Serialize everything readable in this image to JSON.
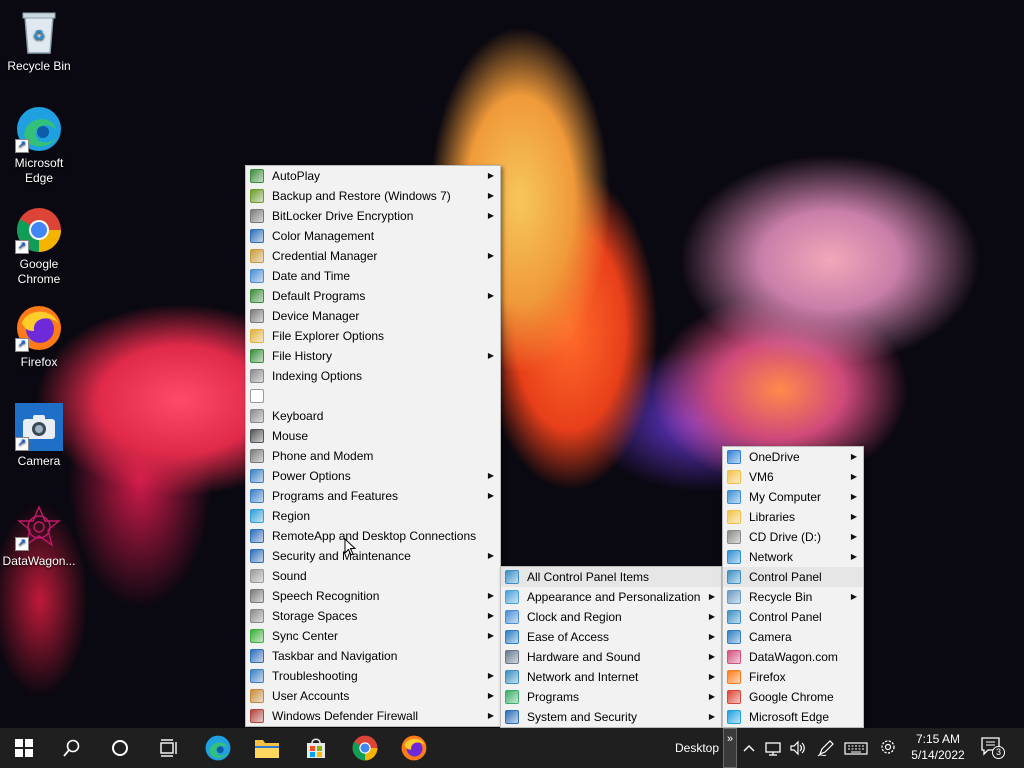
{
  "desktop_icons": [
    {
      "label": "Recycle Bin",
      "icon": "recycle-bin-icon"
    },
    {
      "label": "Microsoft Edge",
      "icon": "edge-icon"
    },
    {
      "label": "Google Chrome",
      "icon": "chrome-icon"
    },
    {
      "label": "Firefox",
      "icon": "firefox-icon"
    },
    {
      "label": "Camera",
      "icon": "camera-icon"
    },
    {
      "label": "DataWagon...",
      "icon": "datawagon-icon"
    }
  ],
  "control_panel_menu": [
    {
      "label": "AutoPlay",
      "submenu": true
    },
    {
      "label": "Backup and Restore (Windows 7)",
      "submenu": true
    },
    {
      "label": "BitLocker Drive Encryption",
      "submenu": true
    },
    {
      "label": "Color Management",
      "submenu": false
    },
    {
      "label": "Credential Manager",
      "submenu": true
    },
    {
      "label": "Date and Time",
      "submenu": false
    },
    {
      "label": "Default Programs",
      "submenu": true
    },
    {
      "label": "Device Manager",
      "submenu": false
    },
    {
      "label": "File Explorer Options",
      "submenu": false
    },
    {
      "label": "File History",
      "submenu": true
    },
    {
      "label": "Indexing Options",
      "submenu": false
    },
    {
      "label": "",
      "submenu": false
    },
    {
      "label": "Keyboard",
      "submenu": false
    },
    {
      "label": "Mouse",
      "submenu": false
    },
    {
      "label": "Phone and Modem",
      "submenu": false
    },
    {
      "label": "Power Options",
      "submenu": true
    },
    {
      "label": "Programs and Features",
      "submenu": true
    },
    {
      "label": "Region",
      "submenu": false
    },
    {
      "label": "RemoteApp and Desktop Connections",
      "submenu": false
    },
    {
      "label": "Security and Maintenance",
      "submenu": true
    },
    {
      "label": "Sound",
      "submenu": false
    },
    {
      "label": "Speech Recognition",
      "submenu": true
    },
    {
      "label": "Storage Spaces",
      "submenu": true
    },
    {
      "label": "Sync Center",
      "submenu": true
    },
    {
      "label": "Taskbar and Navigation",
      "submenu": false
    },
    {
      "label": "Troubleshooting",
      "submenu": true
    },
    {
      "label": "User Accounts",
      "submenu": true
    },
    {
      "label": "Windows Defender Firewall",
      "submenu": true
    }
  ],
  "category_menu": [
    {
      "label": "All Control Panel Items",
      "submenu": false
    },
    {
      "label": "Appearance and Personalization",
      "submenu": true
    },
    {
      "label": "Clock and Region",
      "submenu": true
    },
    {
      "label": "Ease of Access",
      "submenu": true
    },
    {
      "label": "Hardware and Sound",
      "submenu": true
    },
    {
      "label": "Network and Internet",
      "submenu": true
    },
    {
      "label": "Programs",
      "submenu": true
    },
    {
      "label": "System and Security",
      "submenu": true
    }
  ],
  "desktop_menu": [
    {
      "label": "OneDrive",
      "submenu": true
    },
    {
      "label": "VM6",
      "submenu": true
    },
    {
      "label": "My Computer",
      "submenu": true
    },
    {
      "label": "Libraries",
      "submenu": true
    },
    {
      "label": "CD Drive (D:)",
      "submenu": true
    },
    {
      "label": "Network",
      "submenu": true
    },
    {
      "label": "Control Panel",
      "submenu": false
    },
    {
      "label": "Recycle Bin",
      "submenu": true
    },
    {
      "label": "Control Panel",
      "submenu": false
    },
    {
      "label": "Camera",
      "submenu": false
    },
    {
      "label": "DataWagon.com",
      "submenu": false
    },
    {
      "label": "Firefox",
      "submenu": false
    },
    {
      "label": "Google Chrome",
      "submenu": false
    },
    {
      "label": "Microsoft Edge",
      "submenu": false
    }
  ],
  "taskbar": {
    "toolbar_label": "Desktop",
    "toolbar_chevron": "»",
    "time": "7:15 AM",
    "date": "5/14/2022",
    "notification_count": "3"
  },
  "colors": {
    "taskbar_bg": "#1f1f1f",
    "menu_bg": "#f2f2f2",
    "menu_highlight": "#e6e6e6"
  }
}
